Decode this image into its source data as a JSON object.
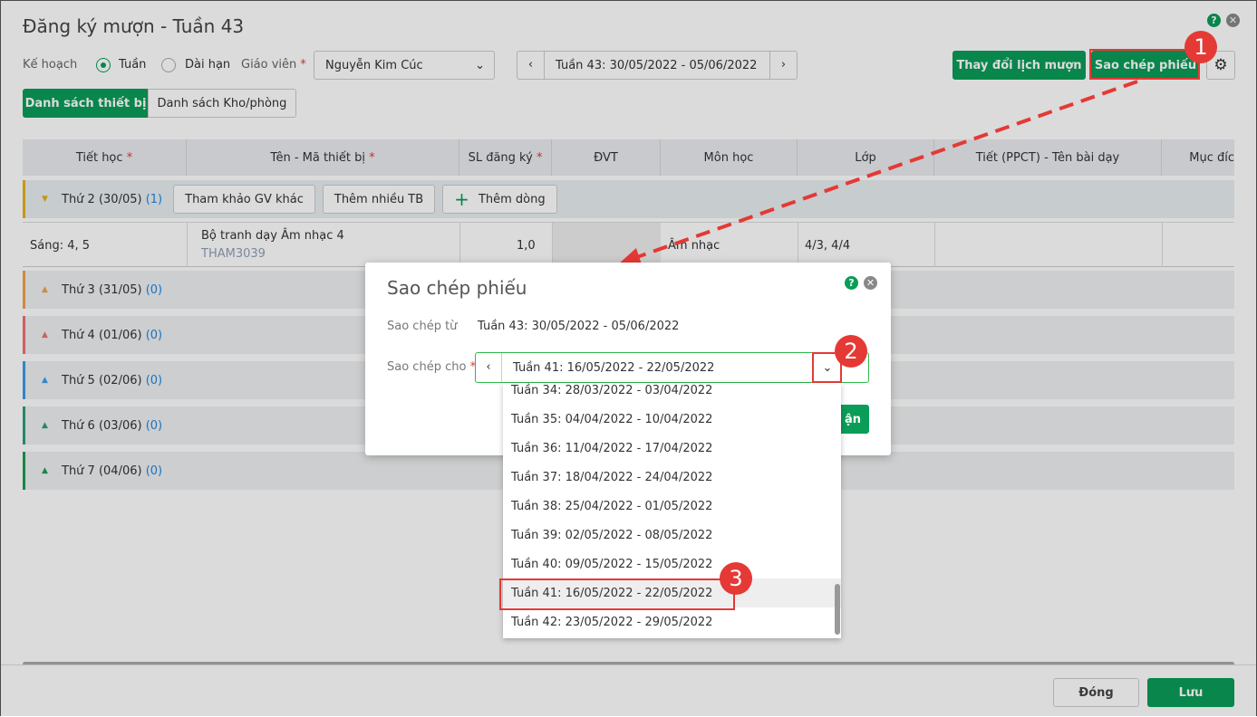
{
  "header": {
    "title": "Đăng ký mượn - Tuần 43",
    "plan_label": "Kế hoạch",
    "plan_options": [
      "Tuần",
      "Dài hạn"
    ],
    "plan_selected": "Tuần",
    "teacher_label": "Giáo viên",
    "teacher_value": "Nguyễn Kim Cúc",
    "week_value": "Tuần 43: 30/05/2022 - 05/06/2022",
    "change_schedule": "Thay đổi lịch mượn",
    "copy_slip": "Sao chép phiếu"
  },
  "tabs": [
    "Danh sách thiết bị",
    "Danh sách Kho/phòng"
  ],
  "table": {
    "columns": [
      "Tiết học",
      "Tên - Mã thiết bị",
      "SL đăng ký",
      "ĐVT",
      "Môn học",
      "Lớp",
      "Tiết (PPCT) - Tên bài dạy",
      "Mục đíc"
    ],
    "days": [
      {
        "label": "Thứ 2 (30/05)",
        "count": "(1)",
        "color": "#e3b21c"
      },
      {
        "label": "Thứ 3 (31/05)",
        "count": "(0)",
        "color": "#f0a04b"
      },
      {
        "label": "Thứ 4 (01/06)",
        "count": "(0)",
        "color": "#ef7070"
      },
      {
        "label": "Thứ 5 (02/06)",
        "count": "(0)",
        "color": "#3d9be9"
      },
      {
        "label": "Thứ 6 (03/06)",
        "count": "(0)",
        "color": "#2e9d7a"
      },
      {
        "label": "Thứ 7 (04/06)",
        "count": "(0)",
        "color": "#1f9d55"
      }
    ],
    "day_buttons": [
      "Tham khảo GV khác",
      "Thêm nhiều TB",
      "Thêm dòng"
    ],
    "row": {
      "period": "Sáng: 4, 5",
      "name": "Bộ tranh dạy Âm nhạc 4",
      "code": "THAM3039",
      "qty": "1,0",
      "subject": "Âm nhạc",
      "class": "4/3, 4/4"
    }
  },
  "modal": {
    "title": "Sao chép phiếu",
    "from_label": "Sao chép từ",
    "from_value": "Tuần 43: 30/05/2022 - 05/06/2022",
    "to_label": "Sao chép cho",
    "to_value": "Tuần 41: 16/05/2022 - 22/05/2022",
    "confirm": "ận",
    "options": [
      "Tuần 34: 28/03/2022 - 03/04/2022",
      "Tuần 35: 04/04/2022 - 10/04/2022",
      "Tuần 36: 11/04/2022 - 17/04/2022",
      "Tuần 37: 18/04/2022 - 24/04/2022",
      "Tuần 38: 25/04/2022 - 01/05/2022",
      "Tuần 39: 02/05/2022 - 08/05/2022",
      "Tuần 40: 09/05/2022 - 15/05/2022",
      "Tuần 41: 16/05/2022 - 22/05/2022",
      "Tuần 42: 23/05/2022 - 29/05/2022"
    ],
    "highlighted": "Tuần 41: 16/05/2022 - 22/05/2022"
  },
  "footer": {
    "close": "Đóng",
    "save": "Lưu"
  },
  "steps": [
    "1",
    "2",
    "3"
  ],
  "colors": {
    "accent": "#0a9d58",
    "annotation": "#e53935"
  }
}
